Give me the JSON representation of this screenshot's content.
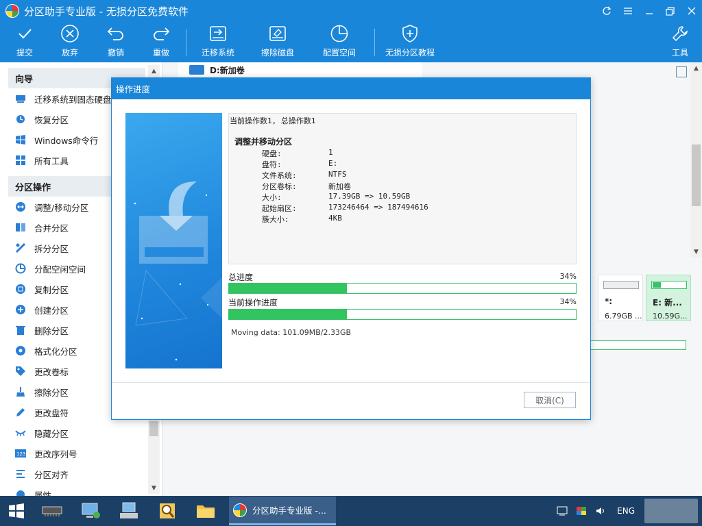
{
  "window": {
    "title": "分区助手专业版 - 无损分区免费软件",
    "controls": [
      "refresh-icon",
      "menu-icon",
      "minimize-icon",
      "restore-icon",
      "close-icon"
    ]
  },
  "toolbar": {
    "commit": "提交",
    "discard": "放弃",
    "undo": "撤销",
    "redo": "重做",
    "migrate_os": "迁移系统",
    "wipe_disk": "擦除磁盘",
    "allocate_space": "配置空间",
    "tutorial": "无损分区教程",
    "tools": "工具"
  },
  "sidebar": {
    "wizard_header": "向导",
    "wizard_items": [
      {
        "label": "迁移系统到固态硬盘",
        "icon": "ssd-icon"
      },
      {
        "label": "恢复分区",
        "icon": "recover-icon"
      },
      {
        "label": "Windows命令行",
        "icon": "windows-icon"
      },
      {
        "label": "所有工具",
        "icon": "grid-icon"
      }
    ],
    "ops_header": "分区操作",
    "ops_items": [
      {
        "label": "调整/移动分区",
        "icon": "resize-icon"
      },
      {
        "label": "合并分区",
        "icon": "merge-icon"
      },
      {
        "label": "拆分分区",
        "icon": "split-icon"
      },
      {
        "label": "分配空闲空间",
        "icon": "allocate-icon"
      },
      {
        "label": "复制分区",
        "icon": "copy-icon"
      },
      {
        "label": "创建分区",
        "icon": "create-icon"
      },
      {
        "label": "删除分区",
        "icon": "delete-icon"
      },
      {
        "label": "格式化分区",
        "icon": "format-icon"
      },
      {
        "label": "更改卷标",
        "icon": "tag-icon"
      },
      {
        "label": "擦除分区",
        "icon": "wipe-icon"
      },
      {
        "label": "更改盘符",
        "icon": "pencil-icon"
      },
      {
        "label": "隐藏分区",
        "icon": "eye-hide-icon"
      },
      {
        "label": "更改序列号",
        "icon": "serial-icon"
      },
      {
        "label": "分区对齐",
        "icon": "align-icon"
      },
      {
        "label": "属性",
        "icon": "props-icon"
      }
    ]
  },
  "main": {
    "disk_label": "D:新加卷",
    "partitions": [
      {
        "name": "*:",
        "size": "6.79GB ..."
      },
      {
        "name": "E: 新...",
        "size": "10.59G..."
      }
    ]
  },
  "dialog": {
    "title": "操作进度",
    "summary": "当前操作数1, 总操作数1",
    "operation": "调整并移动分区",
    "details": [
      {
        "key": "硬盘:",
        "value": "1"
      },
      {
        "key": "盘符:",
        "value": "E:"
      },
      {
        "key": "文件系统:",
        "value": "NTFS"
      },
      {
        "key": "分区卷标:",
        "value": "新加卷"
      },
      {
        "key": "大小:",
        "value": "17.39GB => 10.59GB"
      },
      {
        "key": "起始扇区:",
        "value": "173246464 => 187494616"
      },
      {
        "key": "簇大小:",
        "value": "4KB"
      }
    ],
    "total_label": "总进度",
    "total_pct": "34%",
    "total_fraction": 0.34,
    "current_label": "当前操作进度",
    "current_pct": "34%",
    "current_fraction": 0.34,
    "moving": "Moving data: 101.09MB/2.33GB",
    "cancel": "取消(C)"
  },
  "taskbar": {
    "app_label": "分区助手专业版 -...",
    "lang": "ENG"
  },
  "colors": {
    "accent": "#1a86d9",
    "progress": "#31c45f",
    "taskbar": "#1c3f66"
  }
}
